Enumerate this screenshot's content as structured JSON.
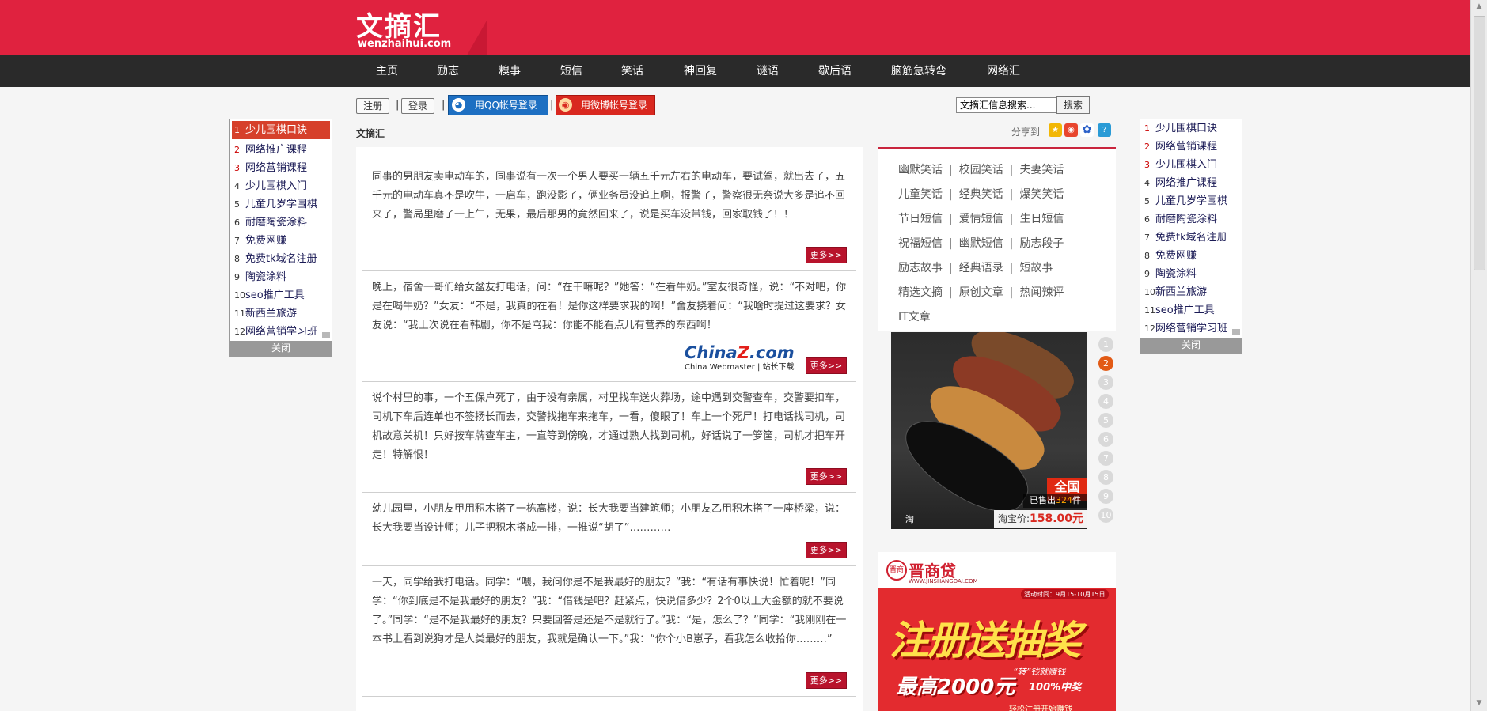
{
  "site": {
    "logo_cn": "文摘汇",
    "logo_en": "wenzhaihui.com"
  },
  "nav": [
    "主页",
    "励志",
    "糗事",
    "短信",
    "笑话",
    "神回复",
    "谜语",
    "歇后语",
    "脑筋急转弯",
    "网络汇"
  ],
  "toolbar": {
    "register": "注册",
    "login": "登录",
    "sep": "|",
    "qq_login": "用QQ帐号登录",
    "weibo_login": "用微博帐号登录",
    "search_value": "文摘汇信息搜索...",
    "search_button": "搜索"
  },
  "breadcrumb": "文摘汇",
  "share_label": "分享到",
  "posts": [
    "同事的男朋友卖电动车的，同事说有一次一个男人要买一辆五千元左右的电动车，要试驾，就出去了，五千元的电动车真不是吹牛，一启车，跑没影了，俩业务员没追上啊，报警了，警察很无奈说大多是追不回来了，警局里磨了一上午，无果，最后那男的竟然回来了，说是买车没带钱，回家取钱了！！",
    "晚上，宿舍一哥们给女盆友打电话，问：“在干嘛呢？”她答：“在看牛奶。”室友很奇怪，说：“不对吧，你是在喝牛奶？”女友：“不是，我真的在看！是你这样要求我的啊！”舍友挠着问：“我啥时提过这要求？女友说：“我上次说在看韩剧，你不是骂我：你能不能看点儿有营养的东西啊！",
    "说个村里的事，一个五保户死了，由于没有亲属，村里找车送火葬场，途中遇到交警查车，交警要扣车，司机下车后连单也不签扬长而去，交警找拖车来拖车，一看，傻眼了！车上一个死尸！打电话找司机，司机故意关机！只好按车牌查车主，一直等到傍晚，才通过熟人找到司机，好话说了一箩筐，司机才把车开走！特解恨！",
    "幼儿园里，小朋友甲用积木搭了一栋高楼，说：长大我要当建筑师；小朋友乙用积木搭了一座桥梁，说：长大我要当设计师；儿子把积木搭成一排，一推说“胡了”…………",
    "一天，同学给我打电话。同学：“喂，我问你是不是我最好的朋友？”我：“有话有事快说！忙着呢！”同学：“你到底是不是我最好的朋友？”我：“借钱是吧？赶紧点，快说借多少？2个0以上大金额的就不要说了。”同学：“是不是我最好的朋友？只要回答是还是不是就行了。”我：“是，怎么了？”同学：“我刚刚在一本书上看到说狗才是人类最好的朋友，我就是确认一下。”我：“你个小B崽子，看我怎么收拾你………”"
  ],
  "more_label": "更多>>",
  "watermark": {
    "brand_main": "China",
    "brand_z": "Z",
    "brand_tail": ".com",
    "sub": "China Webmaster | 站长下载"
  },
  "categories": [
    [
      "幽默笑话",
      "校园笑话",
      "夫妻笑话"
    ],
    [
      "儿童笑话",
      "经典笑话",
      "爆笑笑话"
    ],
    [
      "节日短信",
      "爱情短信",
      "生日短信"
    ],
    [
      "祝福短信",
      "幽默短信",
      "励志段子"
    ],
    [
      "励志故事",
      "经典语录",
      "短故事"
    ],
    [
      "精选文摘",
      "原创文章",
      "热闻辣评"
    ],
    [
      "IT文章"
    ]
  ],
  "slideshow": {
    "sold_prefix": "已售出",
    "sold_count": "324",
    "sold_suffix": "件",
    "price_label": "淘宝价:",
    "price": "158.00元",
    "tag": "全国",
    "tao_icon": "淘",
    "pages": [
      "1",
      "2",
      "3",
      "4",
      "5",
      "6",
      "7",
      "8",
      "9",
      "10"
    ],
    "active_page": 1
  },
  "ad": {
    "seal": "晋商",
    "brand": "晋商贷",
    "brand_url": "WWW.JINSHANGDAI.COM",
    "date": "活动时间：9月15-10月15日",
    "headline_a": "注册",
    "headline_b": "送抽奖",
    "max": "最高2000元",
    "sub": "“转”钱就赚钱",
    "sub2": "100%中奖",
    "foot": "轻松注册开始赚钱"
  },
  "left_list": {
    "items": [
      "少儿围棋口诀",
      "网络推广课程",
      "网络营销课程",
      "少儿围棋入门",
      "儿童几岁学围棋",
      "耐磨陶瓷涂料",
      "免费网赚",
      "免费tk域名注册",
      "陶瓷涂料",
      "seo推广工具",
      "新西兰旅游",
      "网络营销学习班"
    ],
    "close": "关闭"
  },
  "right_list": {
    "items": [
      "少儿围棋口诀",
      "网络营销课程",
      "少儿围棋入门",
      "网络推广课程",
      "儿童几岁学围棋",
      "耐磨陶瓷涂料",
      "免费tk域名注册",
      "免费网赚",
      "陶瓷涂料",
      "新西兰旅游",
      "seo推广工具",
      "网络营销学习班"
    ],
    "close": "关闭"
  },
  "colors": {
    "brand_red": "#e0223f",
    "nav_bg": "#2a2a2a",
    "more_red": "#b8132c",
    "active_dot": "#e25a15"
  },
  "icons": [
    "qq-icon",
    "weibo-icon",
    "share-qzone-icon",
    "share-weibo-icon",
    "share-baidu-icon",
    "share-more-icon",
    "taobao-icon",
    "scroll-up-icon",
    "scroll-down-icon"
  ]
}
